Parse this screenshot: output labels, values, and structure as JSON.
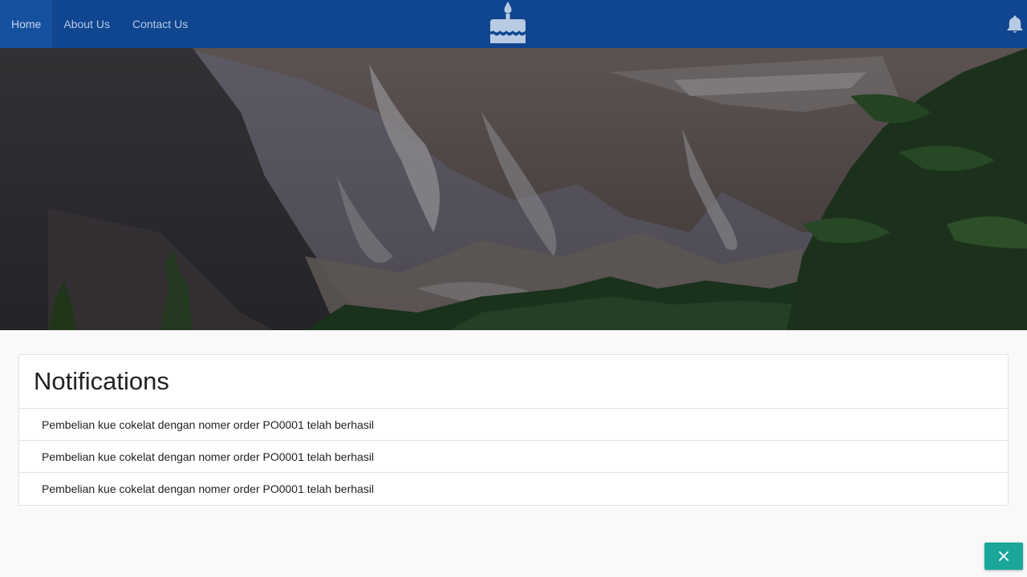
{
  "navbar": {
    "items": [
      {
        "label": "Home",
        "active": true
      },
      {
        "label": "About Us",
        "active": false
      },
      {
        "label": "Contact Us",
        "active": false
      }
    ],
    "brand_icon": "birthday-cake-icon",
    "notification_icon": "bell-icon",
    "background_color": "#10458f"
  },
  "hero": {
    "image": "mountain-landscape"
  },
  "notifications": {
    "title": "Notifications",
    "items": [
      {
        "text": "Pembelian kue cokelat dengan nomer order PO0001 telah berhasil"
      },
      {
        "text": "Pembelian kue cokelat dengan nomer order PO0001 telah berhasil"
      },
      {
        "text": "Pembelian kue cokelat dengan nomer order PO0001 telah berhasil"
      }
    ]
  },
  "fab": {
    "icon": "close-icon",
    "color": "#1aa79a"
  }
}
